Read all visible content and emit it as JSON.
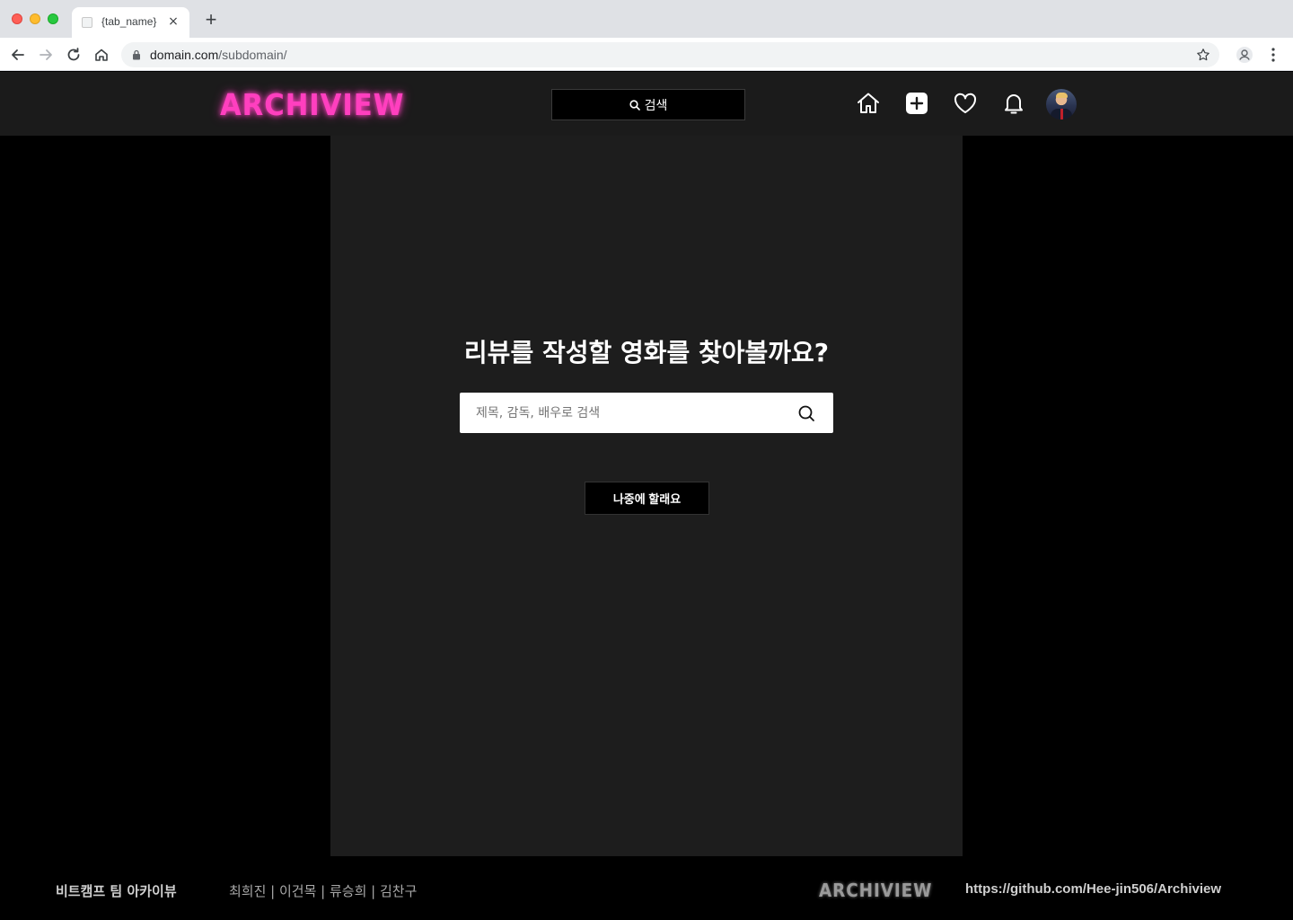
{
  "browser": {
    "tab_title": "{tab_name}",
    "tab_close": "×",
    "new_tab": "+",
    "url_domain": "domain.com",
    "url_path": "/subdomain/"
  },
  "header": {
    "logo": "ARCHIVIEW",
    "search_label": "검색",
    "icons": [
      "home-icon",
      "add-icon",
      "heart-icon",
      "bell-icon"
    ]
  },
  "main": {
    "title": "리뷰를 작성할 영화를 찾아볼까요?",
    "search_placeholder": "제목, 감독, 배우로 검색",
    "later_button": "나중에 할래요"
  },
  "footer": {
    "team": "비트캠프 팀 아카이뷰",
    "members": "최희진 | 이건목 | 류승희 | 김찬구",
    "logo": "ARCHIVIEW",
    "github": "https://github.com/Hee-jin506/Archiview"
  },
  "colors": {
    "accent": "#ff3fbf",
    "header_bg": "#1b1b1b",
    "panel_bg": "#1d1d1d",
    "page_bg": "#000000"
  }
}
